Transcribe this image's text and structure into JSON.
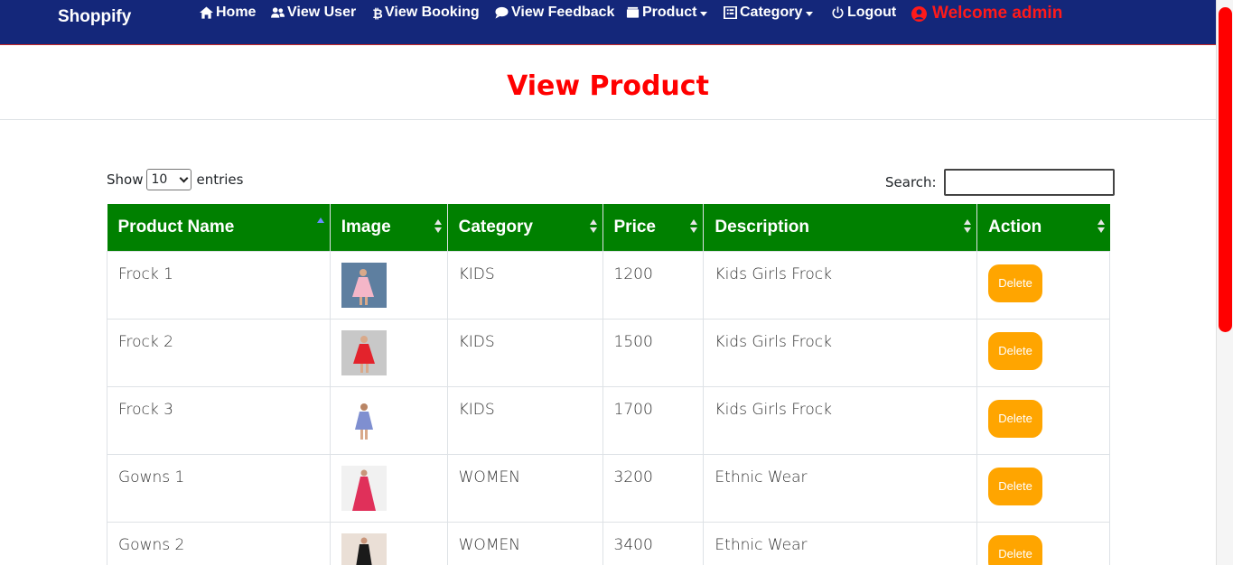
{
  "nav": {
    "brand": "Shoppify",
    "items": [
      {
        "label": "Home",
        "icon": "home-icon"
      },
      {
        "label": "View User",
        "icon": "users-icon"
      },
      {
        "label": "View Booking",
        "icon": "bitcoin-icon"
      },
      {
        "label": "View Feedback",
        "icon": "chat-icon"
      },
      {
        "label": "Product",
        "icon": "box-icon"
      },
      {
        "label": "Category",
        "icon": "list-icon"
      },
      {
        "label": "Logout",
        "icon": "power-icon"
      }
    ],
    "welcome": "Welcome admin"
  },
  "page": {
    "title": "View Product"
  },
  "table_controls": {
    "show_label": "Show",
    "entries_value": "10",
    "entries_label": "entries",
    "search_label": "Search:",
    "search_value": ""
  },
  "table": {
    "columns": [
      "Product Name",
      "Image",
      "Category",
      "Price",
      "Description",
      "Action"
    ],
    "rows": [
      {
        "name": "Frock 1",
        "category": "KIDS",
        "price": "1200",
        "description": "Kids Girls Frock",
        "action": "Delete",
        "image": "girl-pink-frock"
      },
      {
        "name": "Frock 2",
        "category": "KIDS",
        "price": "1500",
        "description": "Kids Girls Frock",
        "action": "Delete",
        "image": "girl-red-frock"
      },
      {
        "name": "Frock 3",
        "category": "KIDS",
        "price": "1700",
        "description": "Kids Girls Frock",
        "action": "Delete",
        "image": "girl-blue-frock"
      },
      {
        "name": "Gowns 1",
        "category": "WOMEN",
        "price": "3200",
        "description": "Ethnic Wear",
        "action": "Delete",
        "image": "woman-red-gown"
      },
      {
        "name": "Gowns 2",
        "category": "WOMEN",
        "price": "3400",
        "description": "Ethnic Wear",
        "action": "Delete",
        "image": "woman-black-gown"
      }
    ]
  },
  "colors": {
    "navbar": "#14277a",
    "header": "#008000",
    "title": "#ff0000",
    "delete": "#ffa500",
    "scroll_thumb": "#ff0000"
  }
}
